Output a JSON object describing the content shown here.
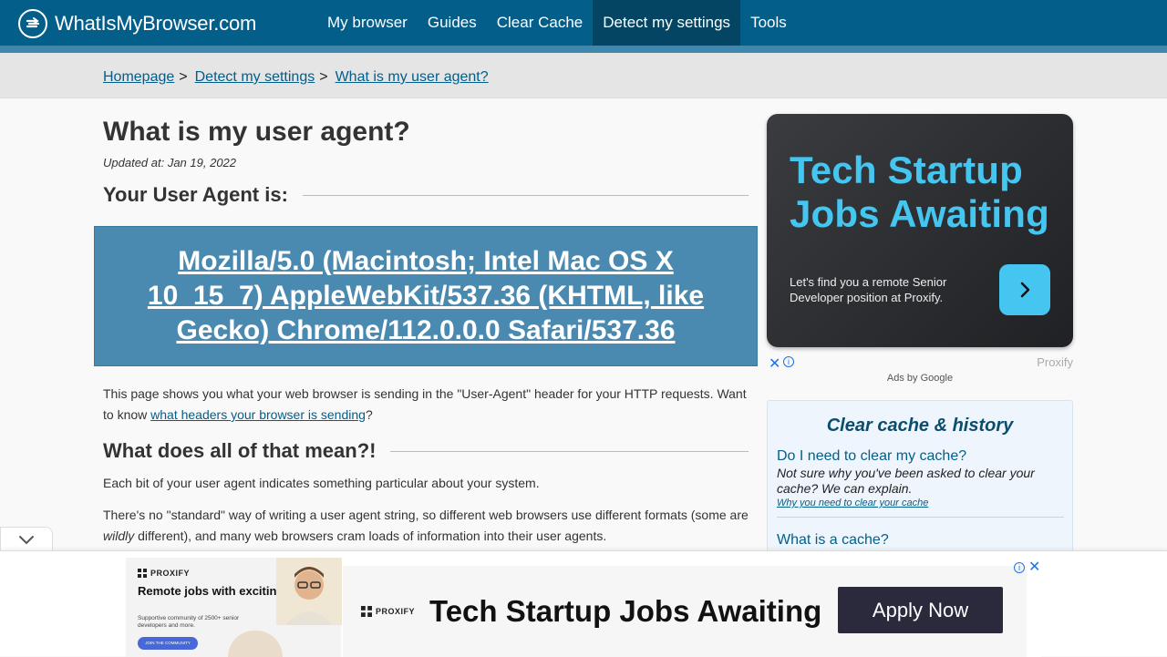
{
  "header": {
    "logo_text": "WhatIsMyBrowser.com",
    "nav": [
      {
        "label": "My browser",
        "active": false
      },
      {
        "label": "Guides",
        "active": false
      },
      {
        "label": "Clear Cache",
        "active": false
      },
      {
        "label": "Detect my settings",
        "active": true
      },
      {
        "label": "Tools",
        "active": false
      }
    ],
    "colors": {
      "bar": "#035e8a",
      "active": "#034562",
      "strip": "#3f87ad"
    }
  },
  "breadcrumb": {
    "items": [
      "Homepage",
      "Detect my settings",
      "What is my user agent?"
    ],
    "separator": ">"
  },
  "main": {
    "title": "What is my user agent?",
    "updated": "Updated at: Jan 19, 2022",
    "your_ua_heading": "Your User Agent is:",
    "user_agent": "Mozilla/5.0 (Macintosh; Intel Mac OS X 10_15_7) AppleWebKit/537.36 (KHTML, like Gecko) Chrome/112.0.0.0 Safari/537.36",
    "intro_before": "This page shows you what your web browser is sending in the \"User-Agent\" header for your HTTP requests. Want to know ",
    "intro_link": "what headers your browser is sending",
    "intro_after": "?",
    "meaning_heading": "What does all of that mean?!",
    "p1": "Each bit of your user agent indicates something particular about your system.",
    "p2_before": "There's no \"standard\" way of writing a user agent string, so different web browsers use different formats (some are ",
    "p2_em": "wildly",
    "p2_after": " different), and many web browsers cram loads of information into their user agents."
  },
  "sidebar_ad": {
    "title": "Tech Startup Jobs Awaiting",
    "body": "Let's find you a remote Senior Developer position at Proxify.",
    "brand": "Proxify",
    "ads_by": "Ads by Google",
    "accent": "#45c6f0"
  },
  "cache_card": {
    "title": "Clear cache & history",
    "q1": "Do I need to clear my cache?",
    "q1_desc": "Not sure why you've been asked to clear your cache? We can explain.",
    "q1_link": "Why you need to clear your cache",
    "q2": "What is a cache?"
  },
  "bottom_ad": {
    "promo_logo": "PROXIFY",
    "promo_head": "Remote jobs with exciting brands!",
    "promo_sub": "Supportive community of 2500+ senior developers and more.",
    "promo_btn": "JOIN THE COMMUNITY",
    "logo": "PROXIFY",
    "title": "Tech Startup Jobs Awaiting",
    "cta": "Apply Now"
  }
}
